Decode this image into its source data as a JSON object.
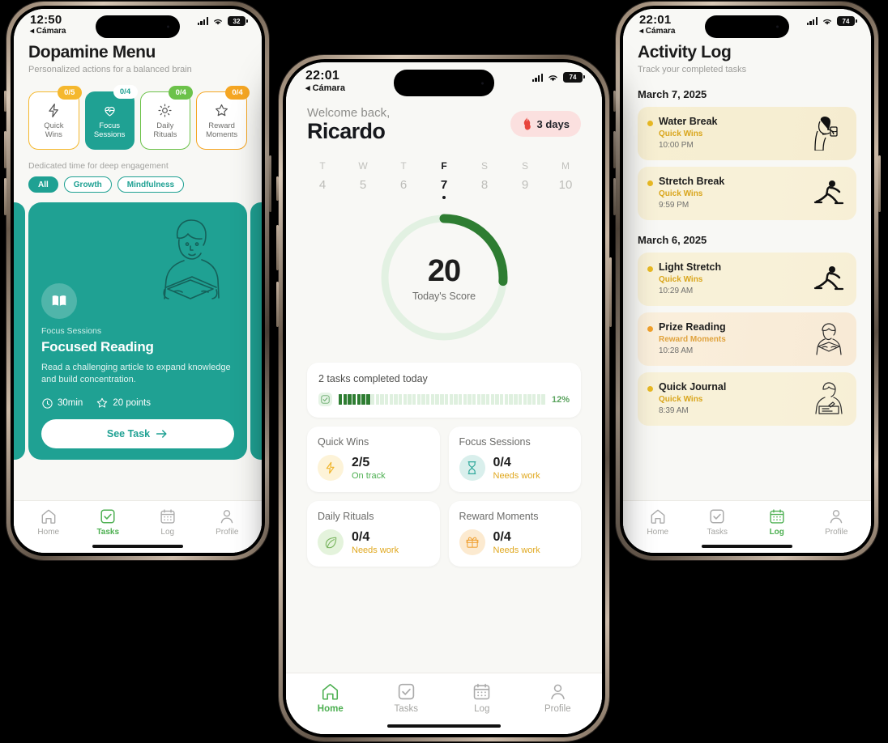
{
  "colors": {
    "teal": "#1fa193",
    "green": "#4caf50",
    "dark_green": "#2e7d32",
    "amber": "#f5b82e",
    "orange": "#f5a623",
    "red": "#e8453c",
    "bg": "#f8f8f5"
  },
  "left_phone": {
    "status": {
      "time": "12:50",
      "back": "◂ Cámara",
      "battery": "32"
    },
    "header": {
      "title": "Dopamine Menu",
      "subtitle": "Personalized actions for a balanced brain"
    },
    "categories": [
      {
        "label": "Quick\nWins",
        "label_l1": "Quick",
        "label_l2": "Wins",
        "badge": "0/5",
        "badge_color": "#f5b82e",
        "icon": "bolt-icon",
        "active": false
      },
      {
        "label": "Focus Sessions",
        "label_l1": "Focus",
        "label_l2": "Sessions",
        "badge": "0/4",
        "badge_color": "#ffffff",
        "icon": "heart-pulse-icon",
        "active": true
      },
      {
        "label": "Daily Rituals",
        "label_l1": "Daily",
        "label_l2": "Rituals",
        "badge": "0/4",
        "badge_color": "#6cc24a",
        "icon": "sun-icon",
        "active": false
      },
      {
        "label": "Reward Moments",
        "label_l1": "Reward",
        "label_l2": "Moments",
        "badge": "0/4",
        "badge_color": "#f5a623",
        "icon": "star-icon",
        "active": false
      }
    ],
    "hint": "Dedicated time for deep engagement",
    "filters": [
      {
        "label": "All",
        "selected": true
      },
      {
        "label": "Growth",
        "selected": false
      },
      {
        "label": "Mindfulness",
        "selected": false
      }
    ],
    "task_card": {
      "category": "Focus Sessions",
      "title": "Focused Reading",
      "description": "Read a challenging article to expand knowledge and build concentration.",
      "duration": "30min",
      "points": "20 points",
      "button": "See Task",
      "icon": "book-icon",
      "illustration": "person-reading-illustration"
    },
    "tabs": [
      {
        "label": "Home",
        "icon": "home-icon",
        "active": false
      },
      {
        "label": "Tasks",
        "icon": "checkbox-icon",
        "active": true
      },
      {
        "label": "Log",
        "icon": "calendar-icon",
        "active": false
      },
      {
        "label": "Profile",
        "icon": "person-icon",
        "active": false
      }
    ]
  },
  "mid_phone": {
    "status": {
      "time": "22:01",
      "back": "◂ Cámara",
      "battery": "74"
    },
    "greeting": "Welcome back,",
    "user_name": "Ricardo",
    "streak": {
      "text": "3 days",
      "icon": "flame-icon"
    },
    "week": [
      {
        "day": "T",
        "date": "4",
        "today": false
      },
      {
        "day": "W",
        "date": "5",
        "today": false
      },
      {
        "day": "T",
        "date": "6",
        "today": false
      },
      {
        "day": "F",
        "date": "7",
        "today": true
      },
      {
        "day": "S",
        "date": "8",
        "today": false
      },
      {
        "day": "S",
        "date": "9",
        "today": false
      },
      {
        "day": "M",
        "date": "10",
        "today": false
      }
    ],
    "score": {
      "value": "20",
      "label": "Today's Score",
      "ring_percent": 26
    },
    "progress": {
      "text": "2 tasks completed today",
      "percent_label": "12%",
      "percent": 12,
      "segments": 45,
      "filled": 7
    },
    "stats": [
      {
        "title": "Quick Wins",
        "value": "2/5",
        "status": "On track",
        "status_color": "#4caf50",
        "icon": "bolt-icon",
        "icon_bg": "#fdf3d8",
        "icon_color": "#f0b429"
      },
      {
        "title": "Focus Sessions",
        "value": "0/4",
        "status": "Needs work",
        "status_color": "#e0a81f",
        "icon": "hourglass-icon",
        "icon_bg": "#d9efec",
        "icon_color": "#1fa193"
      },
      {
        "title": "Daily Rituals",
        "value": "0/4",
        "status": "Needs work",
        "status_color": "#e0a81f",
        "icon": "leaf-icon",
        "icon_bg": "#e4f3dc",
        "icon_color": "#7bb661"
      },
      {
        "title": "Reward Moments",
        "value": "0/4",
        "status": "Needs work",
        "status_color": "#e0a81f",
        "icon": "gift-icon",
        "icon_bg": "#fcead0",
        "icon_color": "#f0a43a"
      }
    ],
    "tabs": [
      {
        "label": "Home",
        "icon": "home-icon",
        "active": true
      },
      {
        "label": "Tasks",
        "icon": "checkbox-icon",
        "active": false
      },
      {
        "label": "Log",
        "icon": "calendar-icon",
        "active": false
      },
      {
        "label": "Profile",
        "icon": "person-icon",
        "active": false
      }
    ]
  },
  "right_phone": {
    "status": {
      "time": "22:01",
      "back": "◂ Cámara",
      "battery": "74"
    },
    "header": {
      "title": "Activity Log",
      "subtitle": "Track your completed tasks"
    },
    "groups": [
      {
        "date": "March 7, 2025",
        "entries": [
          {
            "name": "Water Break",
            "category": "Quick Wins",
            "time": "10:00 PM",
            "accent": "#e8b923",
            "bg": "#f8f0d4",
            "illustration": "person-drinking-illustration"
          },
          {
            "name": "Stretch Break",
            "category": "Quick Wins",
            "time": "9:59 PM",
            "accent": "#e8b923",
            "bg": "#f9f2db",
            "illustration": "person-stretching-illustration"
          }
        ]
      },
      {
        "date": "March 6, 2025",
        "entries": [
          {
            "name": "Light Stretch",
            "category": "Quick Wins",
            "time": "10:29 AM",
            "accent": "#e8b923",
            "bg": "#f9f2db",
            "illustration": "person-stretching-illustration"
          },
          {
            "name": "Prize Reading",
            "category": "Reward Moments",
            "time": "10:28 AM",
            "accent": "#f0a02a",
            "bg": "#f9ecdb",
            "illustration": "person-reading-illustration"
          },
          {
            "name": "Quick Journal",
            "category": "Quick Wins",
            "time": "8:39 AM",
            "accent": "#e8b923",
            "bg": "#f9f2db",
            "illustration": "person-writing-illustration"
          }
        ]
      }
    ],
    "tabs": [
      {
        "label": "Home",
        "icon": "home-icon",
        "active": false
      },
      {
        "label": "Tasks",
        "icon": "checkbox-icon",
        "active": false
      },
      {
        "label": "Log",
        "icon": "calendar-icon",
        "active": true
      },
      {
        "label": "Profile",
        "icon": "person-icon",
        "active": false
      }
    ]
  }
}
